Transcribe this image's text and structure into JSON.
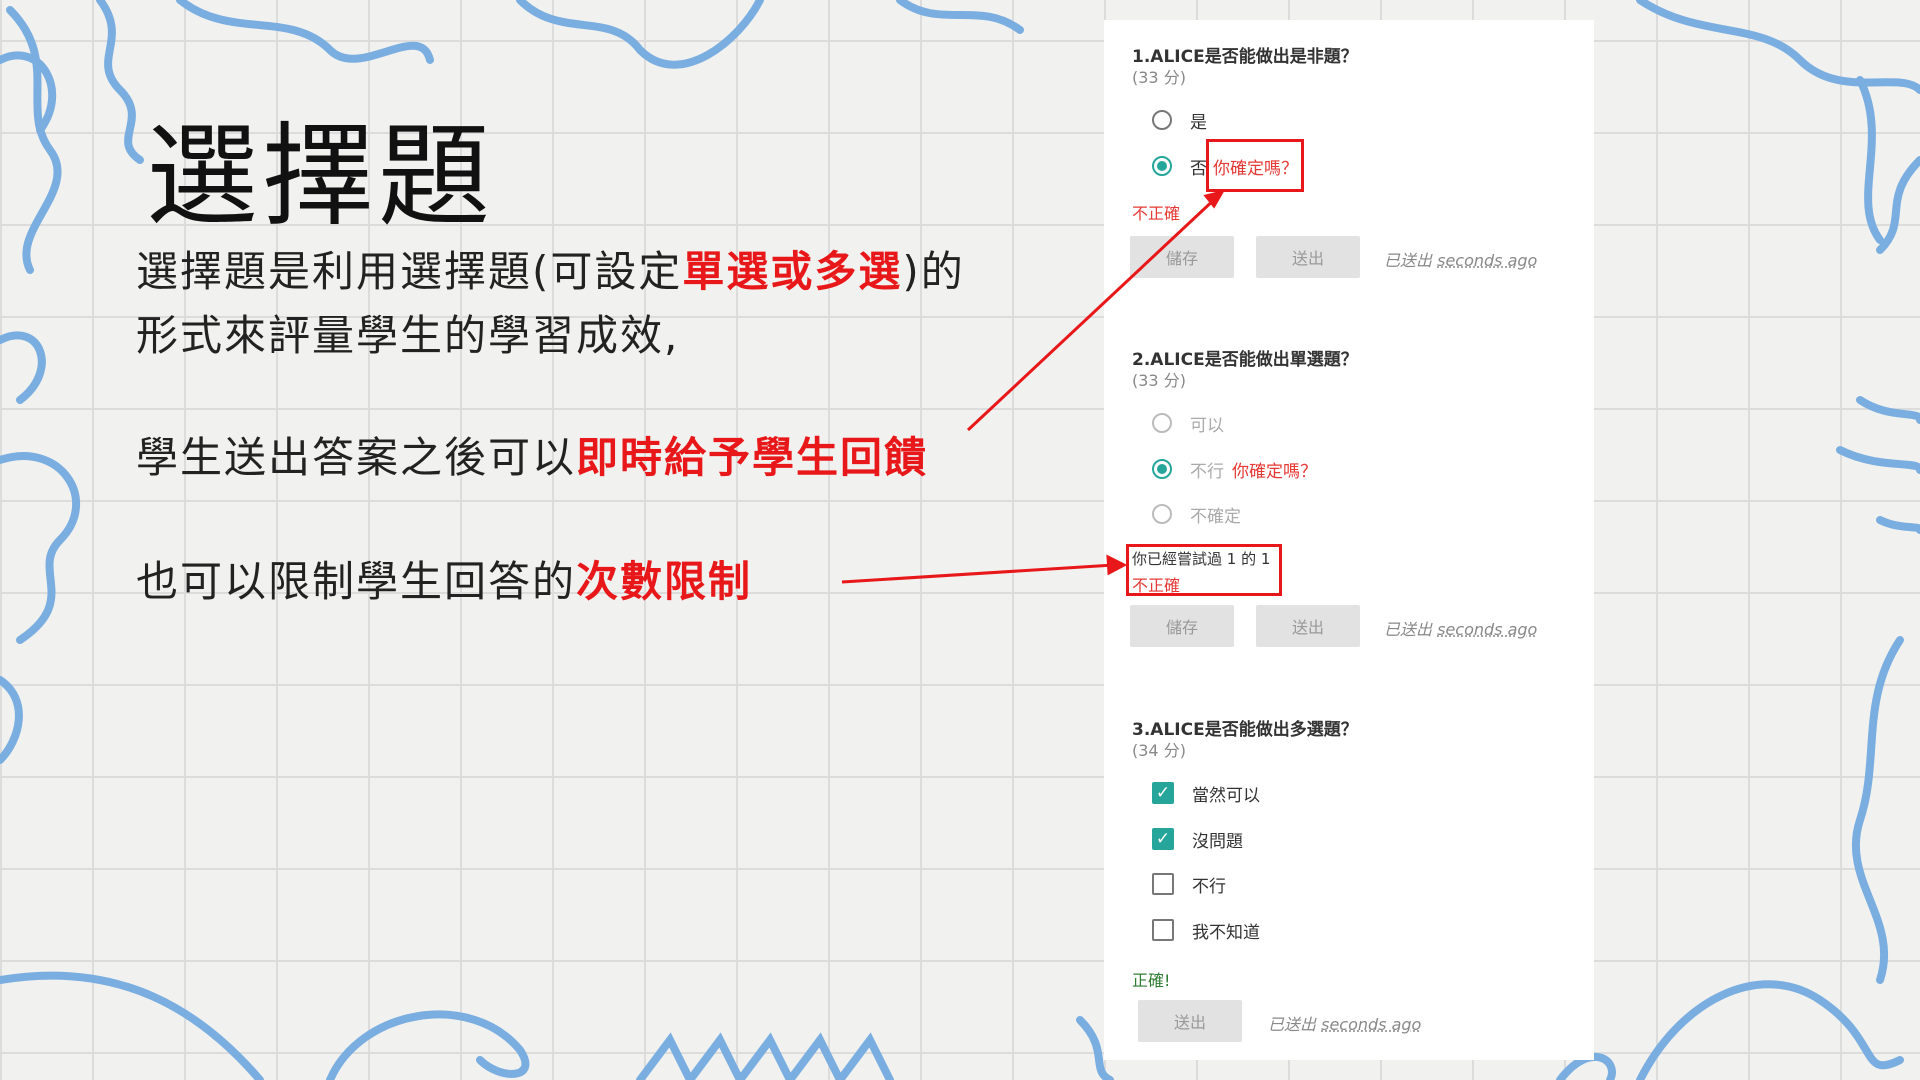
{
  "slide": {
    "title": "選擇題",
    "p1_a": "選擇題是利用選擇題(可設定",
    "p1_b": "單選或多選",
    "p1_c": ")的",
    "p1_d": "形式來評量學生的學習成效,",
    "p2_a": "學生送出答案之後可以",
    "p2_b": "即時給予學生回饋",
    "p3_a": "也可以限制學生回答的",
    "p3_b": "次數限制"
  },
  "quiz": {
    "q1": {
      "title": "1.ALICE是否能做出是非題？",
      "points": "(33 分)",
      "options": [
        "是",
        "否"
      ],
      "feedback": "你確定嗎？",
      "result": "不正確",
      "save": "儲存",
      "submit": "送出",
      "sent_prefix": "已送出",
      "sent_time": "seconds ago"
    },
    "q2": {
      "title": "2.ALICE是否能做出單選題？",
      "points": "(33 分)",
      "options": [
        "可以",
        "不行",
        "不確定"
      ],
      "feedback": "你確定嗎？",
      "attempts": "你已經嘗試過 1 的 1",
      "result": "不正確",
      "save": "儲存",
      "submit": "送出",
      "sent_prefix": "已送出",
      "sent_time": "seconds ago"
    },
    "q3": {
      "title": "3.ALICE是否能做出多選題？",
      "points": "(34 分)",
      "options": [
        "當然可以",
        "沒問題",
        "不行",
        "我不知道"
      ],
      "result": "正確!",
      "submit": "送出",
      "sent_prefix": "已送出",
      "sent_time": "seconds ago"
    }
  },
  "colors": {
    "accent": "#e8181a",
    "teal": "#26a69a",
    "scribble": "#7aaee0"
  }
}
